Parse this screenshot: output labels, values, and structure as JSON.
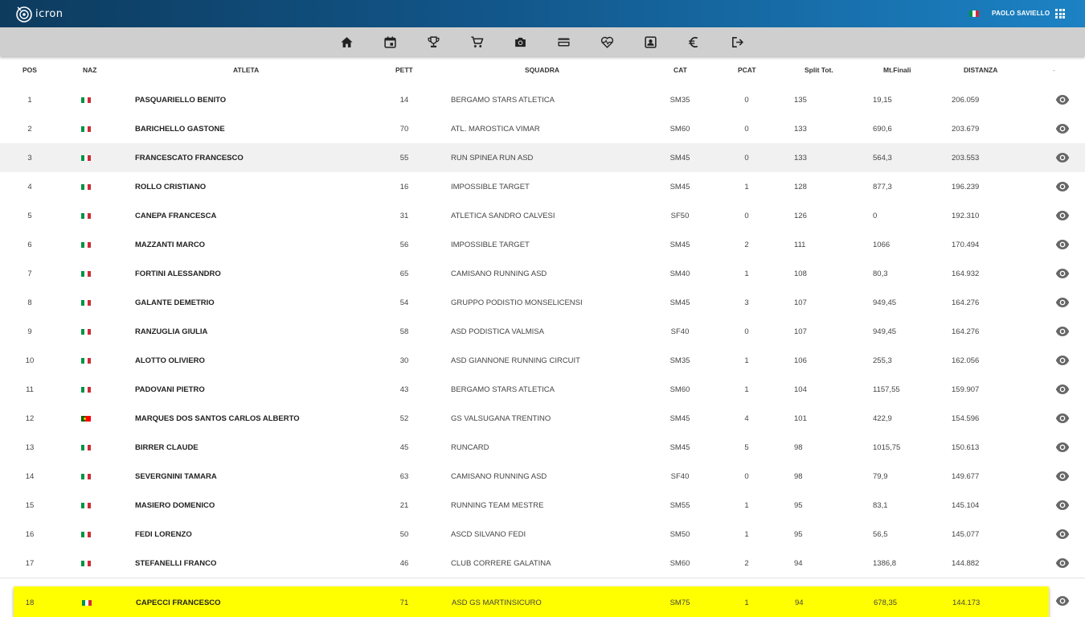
{
  "header": {
    "logo_text": "icron",
    "user_name": "PAOLO SAVIELLO",
    "language_flag": "italy-flag",
    "apps_icon": "apps-grid-icon"
  },
  "toolbar": {
    "icons": [
      "home-icon",
      "calendar-icon",
      "trophy-icon",
      "cart-icon",
      "camera-icon",
      "credit-card-icon",
      "heart-rate-icon",
      "contact-card-icon",
      "euro-icon",
      "logout-icon"
    ]
  },
  "table": {
    "columns": [
      "POS",
      "NAZ",
      "ATLETA",
      "PETT",
      "SQUADRA",
      "CAT",
      "PCAT",
      "Split Tot.",
      "Mt.Finali",
      "DISTANZA",
      "-"
    ],
    "rows": [
      {
        "pos": "1",
        "naz": "ITA",
        "atleta": "PASQUARIELLO BENITO",
        "pett": "14",
        "squadra": "BERGAMO STARS ATLETICA",
        "cat": "SM35",
        "pcat": "0",
        "split": "135",
        "mt": "19,15",
        "dist": "206.059"
      },
      {
        "pos": "2",
        "naz": "ITA",
        "atleta": "BARICHELLO GASTONE",
        "pett": "70",
        "squadra": "ATL. MAROSTICA VIMAR",
        "cat": "SM60",
        "pcat": "0",
        "split": "133",
        "mt": "690,6",
        "dist": "203.679"
      },
      {
        "pos": "3",
        "naz": "ITA",
        "atleta": "FRANCESCATO FRANCESCO",
        "pett": "55",
        "squadra": "RUN SPINEA RUN ASD",
        "cat": "SM45",
        "pcat": "0",
        "split": "133",
        "mt": "564,3",
        "dist": "203.553"
      },
      {
        "pos": "4",
        "naz": "ITA",
        "atleta": "ROLLO CRISTIANO",
        "pett": "16",
        "squadra": "IMPOSSIBLE TARGET",
        "cat": "SM45",
        "pcat": "1",
        "split": "128",
        "mt": "877,3",
        "dist": "196.239"
      },
      {
        "pos": "5",
        "naz": "ITA",
        "atleta": "CANEPA FRANCESCA",
        "pett": "31",
        "squadra": "ATLETICA SANDRO CALVESI",
        "cat": "SF50",
        "pcat": "0",
        "split": "126",
        "mt": "0",
        "dist": "192.310"
      },
      {
        "pos": "6",
        "naz": "ITA",
        "atleta": "MAZZANTI MARCO",
        "pett": "56",
        "squadra": "IMPOSSIBLE TARGET",
        "cat": "SM45",
        "pcat": "2",
        "split": "111",
        "mt": "1066",
        "dist": "170.494"
      },
      {
        "pos": "7",
        "naz": "ITA",
        "atleta": "FORTINI ALESSANDRO",
        "pett": "65",
        "squadra": "CAMISANO RUNNING ASD",
        "cat": "SM40",
        "pcat": "1",
        "split": "108",
        "mt": "80,3",
        "dist": "164.932"
      },
      {
        "pos": "8",
        "naz": "ITA",
        "atleta": "GALANTE DEMETRIO",
        "pett": "54",
        "squadra": "GRUPPO PODISTIO MONSELICENSI",
        "cat": "SM45",
        "pcat": "3",
        "split": "107",
        "mt": "949,45",
        "dist": "164.276"
      },
      {
        "pos": "9",
        "naz": "ITA",
        "atleta": "RANZUGLIA GIULIA",
        "pett": "58",
        "squadra": "ASD PODISTICA VALMISA",
        "cat": "SF40",
        "pcat": "0",
        "split": "107",
        "mt": "949,45",
        "dist": "164.276"
      },
      {
        "pos": "10",
        "naz": "ITA",
        "atleta": "ALOTTO OLIVIERO",
        "pett": "30",
        "squadra": "ASD GIANNONE RUNNING CIRCUIT",
        "cat": "SM35",
        "pcat": "1",
        "split": "106",
        "mt": "255,3",
        "dist": "162.056"
      },
      {
        "pos": "11",
        "naz": "ITA",
        "atleta": "PADOVANI PIETRO",
        "pett": "43",
        "squadra": "BERGAMO STARS ATLETICA",
        "cat": "SM60",
        "pcat": "1",
        "split": "104",
        "mt": "1157,55",
        "dist": "159.907"
      },
      {
        "pos": "12",
        "naz": "POR",
        "atleta": "MARQUES DOS SANTOS CARLOS ALBERTO",
        "pett": "52",
        "squadra": "GS VALSUGANA TRENTINO",
        "cat": "SM45",
        "pcat": "4",
        "split": "101",
        "mt": "422,9",
        "dist": "154.596"
      },
      {
        "pos": "13",
        "naz": "ITA",
        "atleta": "BIRRER CLAUDE",
        "pett": "45",
        "squadra": "RUNCARD",
        "cat": "SM45",
        "pcat": "5",
        "split": "98",
        "mt": "1015,75",
        "dist": "150.613"
      },
      {
        "pos": "14",
        "naz": "ITA",
        "atleta": "SEVERGNINI TAMARA",
        "pett": "63",
        "squadra": "CAMISANO RUNNING ASD",
        "cat": "SF40",
        "pcat": "0",
        "split": "98",
        "mt": "79,9",
        "dist": "149.677"
      },
      {
        "pos": "15",
        "naz": "ITA",
        "atleta": "MASIERO DOMENICO",
        "pett": "21",
        "squadra": "RUNNING TEAM MESTRE",
        "cat": "SM55",
        "pcat": "1",
        "split": "95",
        "mt": "83,1",
        "dist": "145.104"
      },
      {
        "pos": "16",
        "naz": "ITA",
        "atleta": "FEDI LORENZO",
        "pett": "50",
        "squadra": "ASCD SILVANO FEDI",
        "cat": "SM50",
        "pcat": "1",
        "split": "95",
        "mt": "56,5",
        "dist": "145.077"
      },
      {
        "pos": "17",
        "naz": "ITA",
        "atleta": "STEFANELLI FRANCO",
        "pett": "46",
        "squadra": "CLUB CORRERE GALATINA",
        "cat": "SM60",
        "pcat": "2",
        "split": "94",
        "mt": "1386,8",
        "dist": "144.882"
      },
      {
        "pos": "18",
        "naz": "ITA",
        "atleta": "CAPECCI FRANCESCO",
        "pett": "71",
        "squadra": "ASD GS MARTINSICURO",
        "cat": "SM75",
        "pcat": "1",
        "split": "94",
        "mt": "678,35",
        "dist": "144.173"
      }
    ],
    "hovered_row": "3",
    "highlighted_row": "18",
    "colors": {
      "highlight": "#ffff00",
      "hover": "#f1f1f1",
      "header_gradient_start": "#0d3b5e",
      "header_gradient_end": "#1c82c4",
      "toolbar": "#cfcfcf"
    }
  }
}
